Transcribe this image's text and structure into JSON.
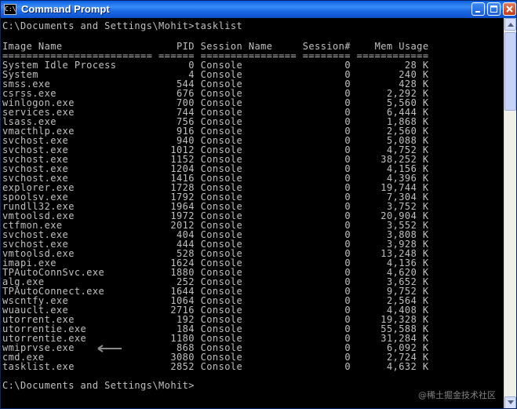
{
  "window": {
    "title": "Command Prompt",
    "icon_text": "C:\\"
  },
  "console": {
    "command_line": "C:\\Documents and Settings\\Mohit>tasklist",
    "blank": "",
    "header": "Image Name                   PID Session Name     Session#    Mem Usage",
    "separator": "========================= ====== ================ ======== ============",
    "processes": [
      {
        "name": "System Idle Process",
        "pid": "0",
        "session": "Console",
        "session_num": "0",
        "mem": "28 K"
      },
      {
        "name": "System",
        "pid": "4",
        "session": "Console",
        "session_num": "0",
        "mem": "240 K"
      },
      {
        "name": "smss.exe",
        "pid": "544",
        "session": "Console",
        "session_num": "0",
        "mem": "428 K"
      },
      {
        "name": "csrss.exe",
        "pid": "676",
        "session": "Console",
        "session_num": "0",
        "mem": "2,292 K"
      },
      {
        "name": "winlogon.exe",
        "pid": "700",
        "session": "Console",
        "session_num": "0",
        "mem": "5,560 K"
      },
      {
        "name": "services.exe",
        "pid": "744",
        "session": "Console",
        "session_num": "0",
        "mem": "6,444 K"
      },
      {
        "name": "lsass.exe",
        "pid": "756",
        "session": "Console",
        "session_num": "0",
        "mem": "1,868 K"
      },
      {
        "name": "vmacthlp.exe",
        "pid": "916",
        "session": "Console",
        "session_num": "0",
        "mem": "2,560 K"
      },
      {
        "name": "svchost.exe",
        "pid": "940",
        "session": "Console",
        "session_num": "0",
        "mem": "5,088 K"
      },
      {
        "name": "svchost.exe",
        "pid": "1012",
        "session": "Console",
        "session_num": "0",
        "mem": "4,752 K"
      },
      {
        "name": "svchost.exe",
        "pid": "1152",
        "session": "Console",
        "session_num": "0",
        "mem": "38,252 K"
      },
      {
        "name": "svchost.exe",
        "pid": "1204",
        "session": "Console",
        "session_num": "0",
        "mem": "4,156 K"
      },
      {
        "name": "svchost.exe",
        "pid": "1416",
        "session": "Console",
        "session_num": "0",
        "mem": "4,396 K"
      },
      {
        "name": "explorer.exe",
        "pid": "1728",
        "session": "Console",
        "session_num": "0",
        "mem": "19,744 K"
      },
      {
        "name": "spoolsv.exe",
        "pid": "1792",
        "session": "Console",
        "session_num": "0",
        "mem": "7,304 K"
      },
      {
        "name": "rundll32.exe",
        "pid": "1964",
        "session": "Console",
        "session_num": "0",
        "mem": "3,752 K"
      },
      {
        "name": "vmtoolsd.exe",
        "pid": "1972",
        "session": "Console",
        "session_num": "0",
        "mem": "20,904 K"
      },
      {
        "name": "ctfmon.exe",
        "pid": "2012",
        "session": "Console",
        "session_num": "0",
        "mem": "3,552 K"
      },
      {
        "name": "svchost.exe",
        "pid": "404",
        "session": "Console",
        "session_num": "0",
        "mem": "3,808 K"
      },
      {
        "name": "svchost.exe",
        "pid": "444",
        "session": "Console",
        "session_num": "0",
        "mem": "3,928 K"
      },
      {
        "name": "vmtoolsd.exe",
        "pid": "528",
        "session": "Console",
        "session_num": "0",
        "mem": "13,248 K"
      },
      {
        "name": "imapi.exe",
        "pid": "1624",
        "session": "Console",
        "session_num": "0",
        "mem": "4,136 K"
      },
      {
        "name": "TPAutoConnSvc.exe",
        "pid": "1880",
        "session": "Console",
        "session_num": "0",
        "mem": "4,620 K"
      },
      {
        "name": "alg.exe",
        "pid": "252",
        "session": "Console",
        "session_num": "0",
        "mem": "3,652 K"
      },
      {
        "name": "TPAutoConnect.exe",
        "pid": "1644",
        "session": "Console",
        "session_num": "0",
        "mem": "9,752 K"
      },
      {
        "name": "wscntfy.exe",
        "pid": "1064",
        "session": "Console",
        "session_num": "0",
        "mem": "2,564 K"
      },
      {
        "name": "wuauclt.exe",
        "pid": "2716",
        "session": "Console",
        "session_num": "0",
        "mem": "4,408 K"
      },
      {
        "name": "utorrent.exe",
        "pid": "192",
        "session": "Console",
        "session_num": "0",
        "mem": "19,328 K"
      },
      {
        "name": "utorrentie.exe",
        "pid": "184",
        "session": "Console",
        "session_num": "0",
        "mem": "55,588 K"
      },
      {
        "name": "utorrentie.exe",
        "pid": "1180",
        "session": "Console",
        "session_num": "0",
        "mem": "31,284 K"
      },
      {
        "name": "wmiprvse.exe",
        "pid": "868",
        "session": "Console",
        "session_num": "0",
        "mem": "6,092 K"
      },
      {
        "name": "cmd.exe",
        "pid": "3080",
        "session": "Console",
        "session_num": "0",
        "mem": "2,724 K"
      },
      {
        "name": "tasklist.exe",
        "pid": "2852",
        "session": "Console",
        "session_num": "0",
        "mem": "4,632 K"
      }
    ],
    "prompt": "C:\\Documents and Settings\\Mohit>"
  },
  "annotation": {
    "arrow_icon": "left-arrow-icon",
    "color": "#8a8a8a"
  },
  "watermark": "@稀土掘金技术社区",
  "colors": {
    "console_bg": "#000000",
    "console_text": "#c0c0c0",
    "titlebar": "#0a5fe3"
  }
}
